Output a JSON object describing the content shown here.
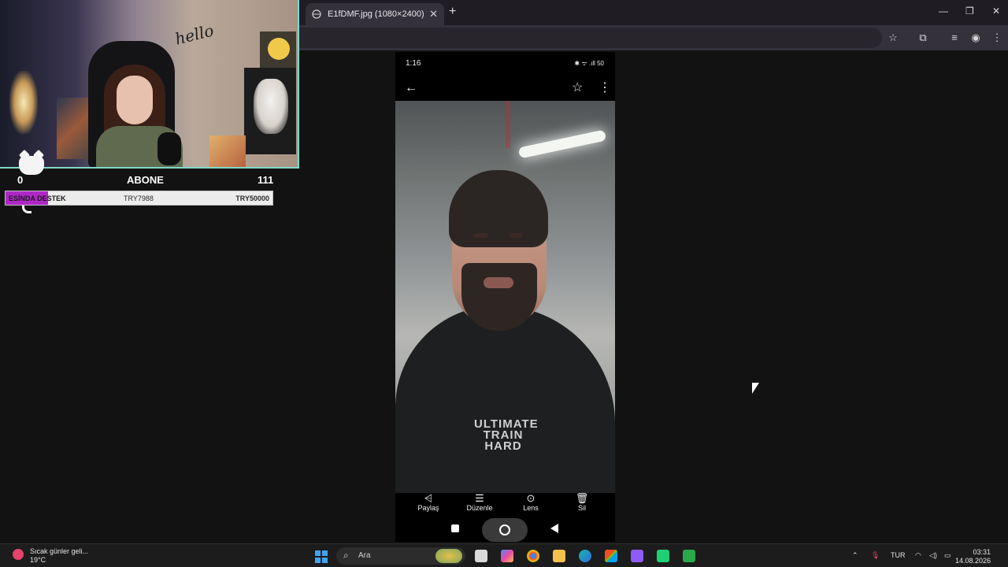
{
  "browser": {
    "tab_title": "E1fDMF.jpg (1080×2400)",
    "tab_close": "✕",
    "new_tab": "+",
    "window_controls": {
      "minimize": "—",
      "restore": "❐",
      "close": "✕"
    }
  },
  "stream_overlay": {
    "goal_left_count": "0",
    "goal_title": "ABONE",
    "goal_right_count": "111",
    "goal_label": "ESİNDA DESTEK",
    "goal_current": "TRY7988",
    "goal_target": "TRY50000",
    "goal_progress": 0.16,
    "accent_color": "#b027c8",
    "webcam_hello_text": "hello"
  },
  "phone": {
    "status_time": "1:16",
    "status_icons": "✱ ᯤ .ıll 50",
    "appbar_back": "←",
    "appbar_star": "☆",
    "appbar_menu": "⋮",
    "shirt_text": "ULTIMATE TRAIN HARD",
    "bottom_actions": [
      {
        "icon": "share-icon",
        "glyph": "⩤",
        "label": "Paylaş"
      },
      {
        "icon": "edit-icon",
        "glyph": "☰",
        "label": "Düzenle"
      },
      {
        "icon": "lens-icon",
        "glyph": "⊙",
        "label": "Lens"
      },
      {
        "icon": "trash-icon",
        "glyph": "🗑",
        "label": "Sil"
      }
    ]
  },
  "taskbar": {
    "weather_title": "Sıcak günler geli...",
    "weather_temp": "19°C",
    "search_placeholder": "Ara",
    "language": "TUR",
    "time": "03:31",
    "date": "14.08.2026",
    "tray_chevron": "⌃"
  }
}
